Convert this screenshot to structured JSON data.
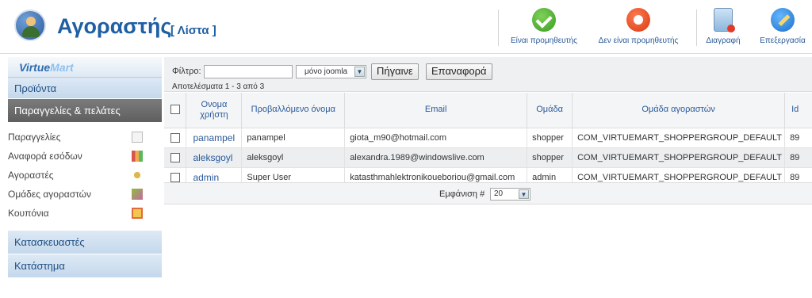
{
  "header": {
    "title": "Αγοραστής",
    "subtitle": "[ Λίστα ]",
    "logo_icon": "user-avatar-icon"
  },
  "toolbar": [
    {
      "label": "Είναι προμηθευτής",
      "icon": "check-icon"
    },
    {
      "label": "Δεν είναι προμηθευτής",
      "icon": "stop-icon"
    },
    {
      "label": "Διαγραφή",
      "icon": "trash-icon"
    },
    {
      "label": "Επεξεργασία",
      "icon": "edit-icon"
    }
  ],
  "sidebar": {
    "logo": {
      "part1": "Virtue",
      "part2": "Mart"
    },
    "sections": {
      "products": "Προϊόντα",
      "orders": "Παραγγελίες & πελάτες",
      "manufacturers": "Κατασκευαστές",
      "store": "Κατάστημα"
    },
    "items": [
      {
        "label": "Παραγγελίες",
        "icon": "copy-icon"
      },
      {
        "label": "Αναφορά εσόδων",
        "icon": "bar-chart-icon"
      },
      {
        "label": "Αγοραστές",
        "icon": "users-icon"
      },
      {
        "label": "Ομάδες αγοραστών",
        "icon": "groups-icon"
      },
      {
        "label": "Κουπόνια",
        "icon": "gift-icon"
      }
    ]
  },
  "filter": {
    "label": "Φίλτρο:",
    "value": "",
    "select_value": "μόνο joomla",
    "go": "Πήγαινε",
    "reset": "Επαναφορά",
    "results": "Αποτελέσματα 1 - 3 από 3"
  },
  "table": {
    "columns": [
      "Ονομα χρήστη",
      "Προβαλλόμενο όνομα",
      "Email",
      "Ομάδα",
      "Ομάδα αγοραστών",
      "Id"
    ],
    "rows": [
      {
        "username": "panampel",
        "display": "panampel",
        "email": "giota_m90@hotmail.com",
        "group": "shopper",
        "shoppergroup": "COM_VIRTUEMART_SHOPPERGROUP_DEFAULT",
        "id": "89"
      },
      {
        "username": "aleksgoyl",
        "display": "aleksgoyl",
        "email": "alexandra.1989@windowslive.com",
        "group": "shopper",
        "shoppergroup": "COM_VIRTUEMART_SHOPPERGROUP_DEFAULT",
        "id": "89"
      },
      {
        "username": "admin",
        "display": "Super User",
        "email": "katasthmahlektronikoueboriou@gmail.com",
        "group": "admin",
        "shoppergroup": "COM_VIRTUEMART_SHOPPERGROUP_DEFAULT",
        "id": "89"
      }
    ]
  },
  "pager": {
    "label": "Εμφάνιση #",
    "value": "20"
  }
}
